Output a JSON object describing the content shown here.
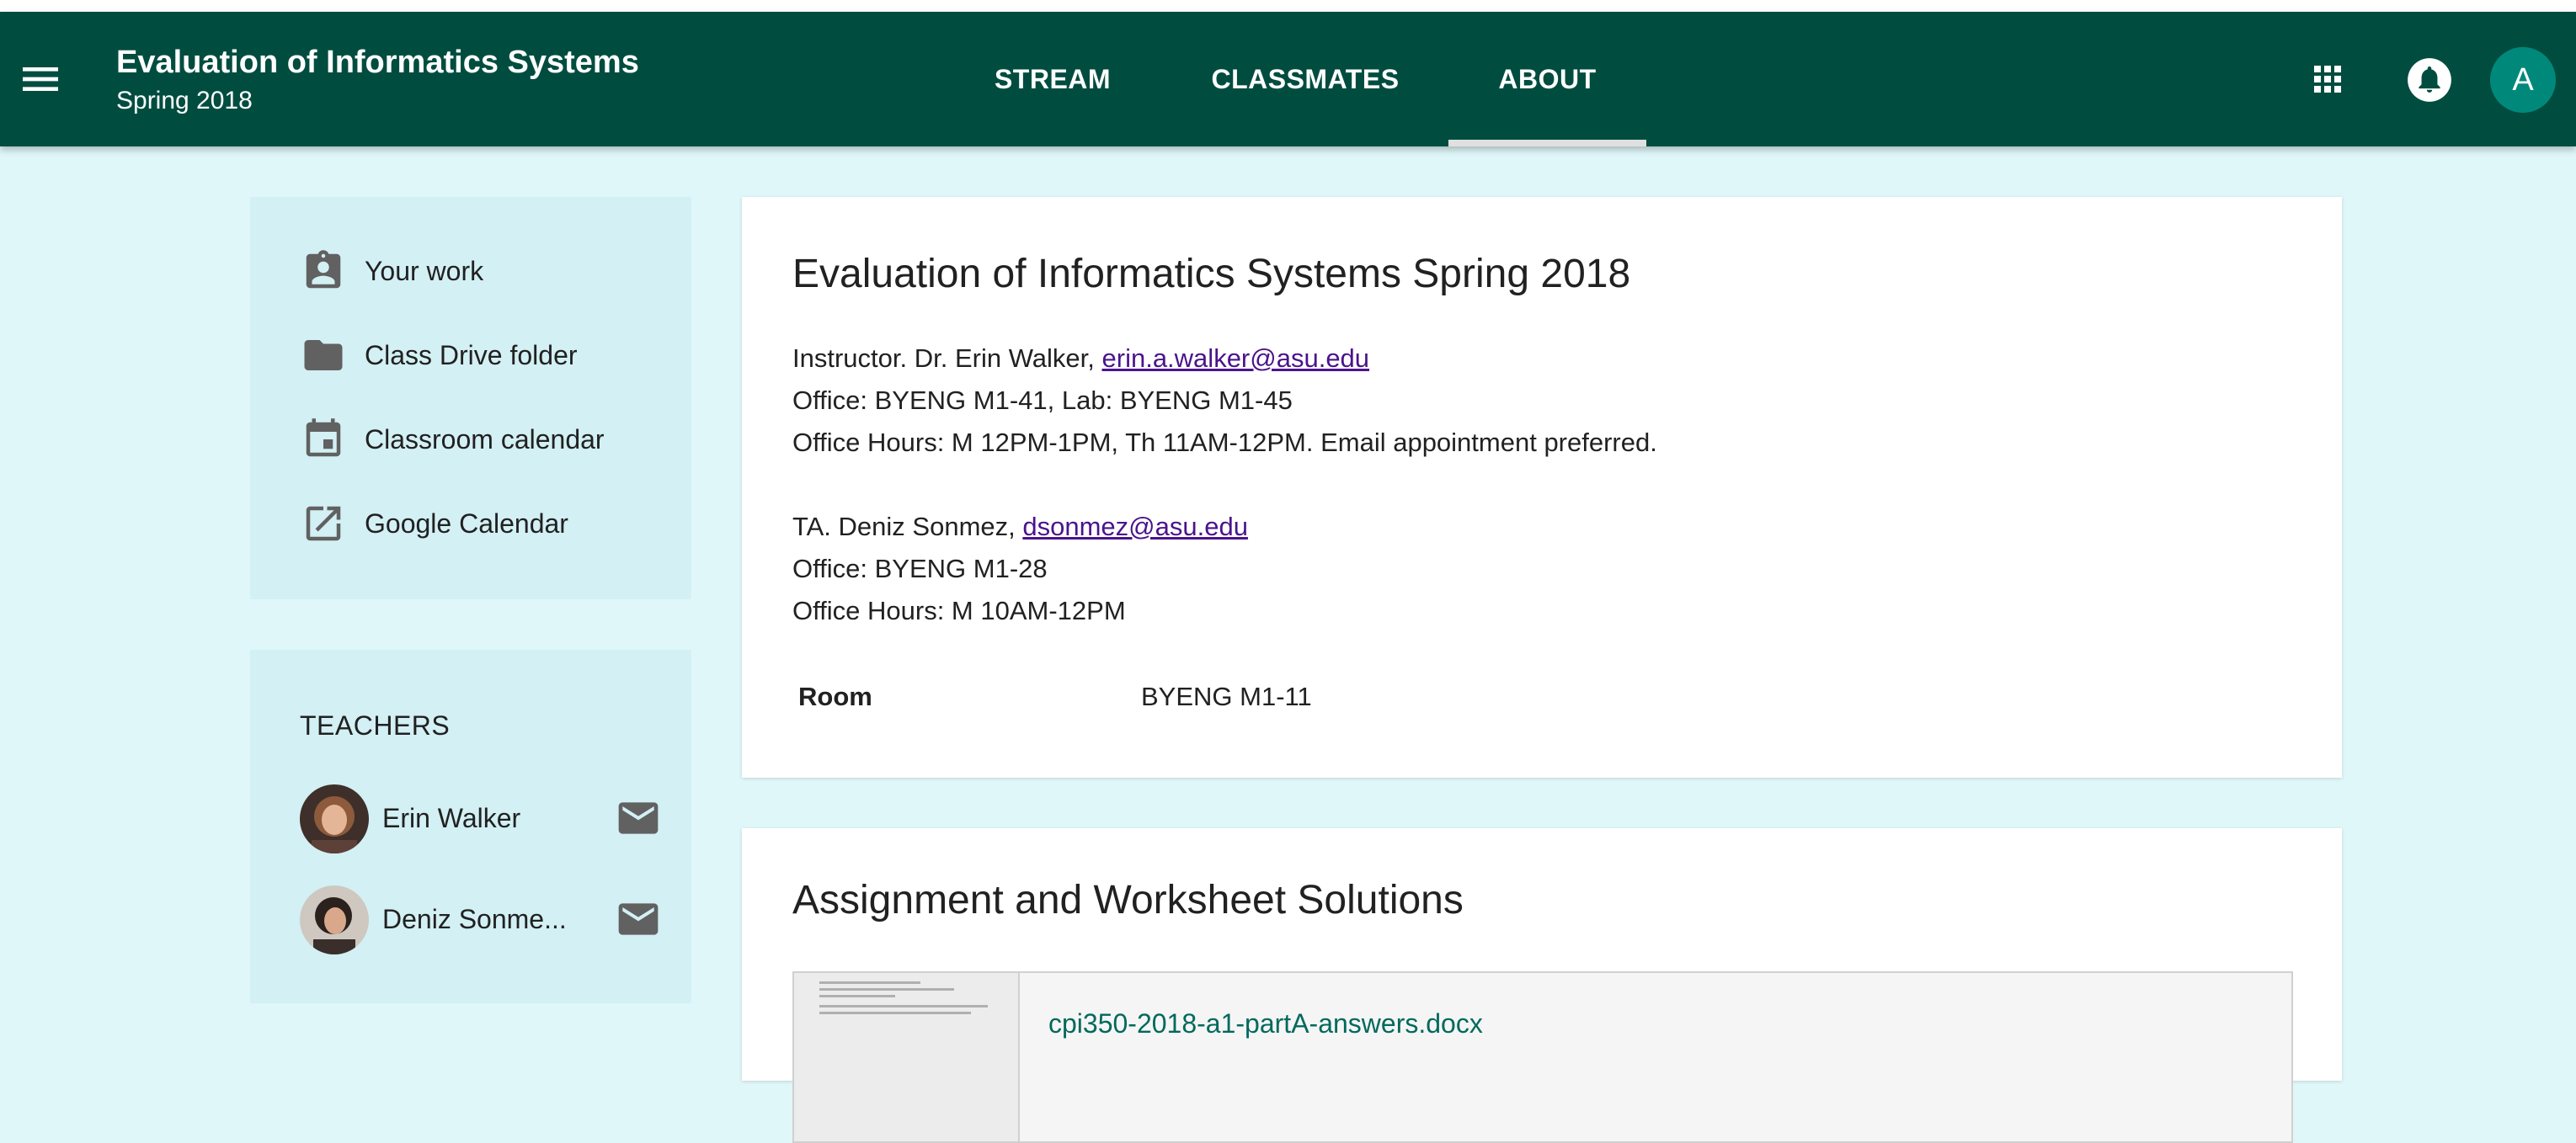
{
  "header": {
    "class_title": "Evaluation of Informatics Systems",
    "class_subtitle": "Spring 2018",
    "tabs": [
      {
        "label": "STREAM"
      },
      {
        "label": "CLASSMATES"
      },
      {
        "label": "ABOUT",
        "active": true
      }
    ],
    "avatar_letter": "A",
    "icons": [
      "menu-icon",
      "apps-grid-icon",
      "notifications-bell-icon"
    ]
  },
  "sidebar": {
    "items": [
      {
        "label": "Your work",
        "icon": "assignment-ind-icon"
      },
      {
        "label": "Class Drive folder",
        "icon": "folder-icon"
      },
      {
        "label": "Classroom calendar",
        "icon": "calendar-icon"
      },
      {
        "label": "Google Calendar",
        "icon": "open-in-new-icon"
      }
    ],
    "teachers_heading": "TEACHERS",
    "teachers": [
      {
        "name": "Erin Walker"
      },
      {
        "name": "Deniz Sonme..."
      }
    ]
  },
  "about": {
    "title": "Evaluation of Informatics Systems Spring 2018",
    "instructor_prefix": "Instructor. Dr. Erin Walker, ",
    "instructor_email": "erin.a.walker@asu.edu",
    "instructor_office": "Office: BYENG M1-41, Lab: BYENG M1-45",
    "instructor_hours": "Office Hours: M 12PM-1PM, Th 11AM-12PM. Email appointment preferred.",
    "ta_prefix": "TA. Deniz Sonmez, ",
    "ta_email": "dsonmez@asu.edu",
    "ta_office": "Office: BYENG M1-28",
    "ta_hours": "Office Hours: M 10AM-12PM",
    "room_label": "Room",
    "room_value": "BYENG M1-11"
  },
  "materials": {
    "title": "Assignment and Worksheet Solutions",
    "attachment_name": "cpi350-2018-a1-partA-answers.docx"
  },
  "colors": {
    "header_bg": "#004d40",
    "page_bg": "#e0f7fa",
    "sidebar_bg": "#d3f0f4",
    "link": "#4a148c",
    "attachment_link": "#00695c",
    "avatar_bg": "#00897b"
  }
}
